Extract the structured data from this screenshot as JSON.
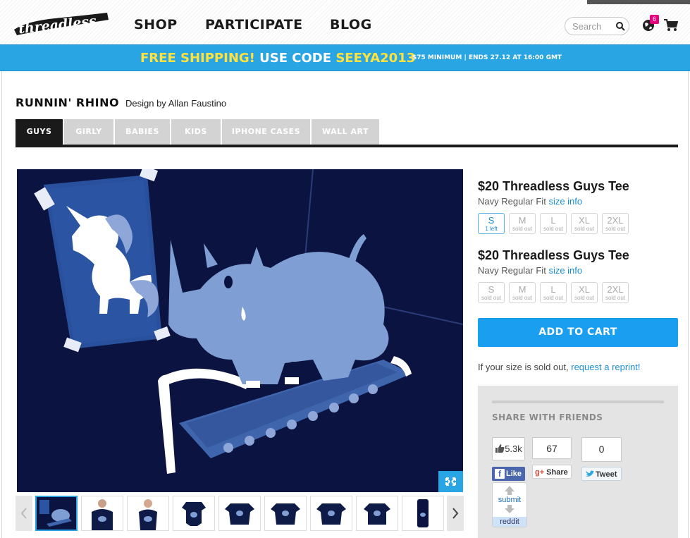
{
  "header": {
    "logo_text": "threadless",
    "nav": [
      "SHOP",
      "PARTICIPATE",
      "BLOG"
    ],
    "search_placeholder": "Search",
    "notification_count": "6"
  },
  "promo": {
    "free_shipping": "FREE SHIPPING!",
    "use_code": "USE CODE",
    "code": "SEEYA2013",
    "note": "$75 MINIMUM | ENDS 27.12 AT 16:00 GMT"
  },
  "product": {
    "title": "RUNNIN' RHINO",
    "byline": "Design by Allan Faustino"
  },
  "tabs": [
    "GUYS",
    "GIRLY",
    "BABIES",
    "KIDS",
    "IPHONE CASES",
    "WALL ART"
  ],
  "options": [
    {
      "title": "$20 Threadless Guys Tee",
      "fit": "Navy Regular Fit",
      "size_info": "size info",
      "sizes": [
        {
          "size": "S",
          "note": "1 left"
        },
        {
          "size": "M",
          "note": "sold out"
        },
        {
          "size": "L",
          "note": "sold out"
        },
        {
          "size": "XL",
          "note": "sold out"
        },
        {
          "size": "2XL",
          "note": "sold out"
        }
      ]
    },
    {
      "title": "$20 Threadless Guys Tee",
      "fit": "Navy Regular Fit",
      "size_info": "size info",
      "sizes": [
        {
          "size": "S",
          "note": "sold out"
        },
        {
          "size": "M",
          "note": "sold out"
        },
        {
          "size": "L",
          "note": "sold out"
        },
        {
          "size": "XL",
          "note": "sold out"
        },
        {
          "size": "2XL",
          "note": "sold out"
        }
      ]
    }
  ],
  "cart": {
    "add_label": "ADD TO CART",
    "soldout_text": "If your size is sold out,",
    "reprint_link": "request a reprint!"
  },
  "share": {
    "title": "SHARE WITH FRIENDS",
    "facebook_count": "5.3k",
    "facebook_label": "Like",
    "gplus_count": "67",
    "gplus_label": "Share",
    "twitter_count": "0",
    "twitter_label": "Tweet",
    "reddit_submit": "submit",
    "reddit_label": "reddit"
  },
  "colors": {
    "accent_blue": "#1a9ef0",
    "promo_blue": "#29a5e3",
    "promo_yellow": "#ffe23d",
    "navy": "#0b1440"
  }
}
